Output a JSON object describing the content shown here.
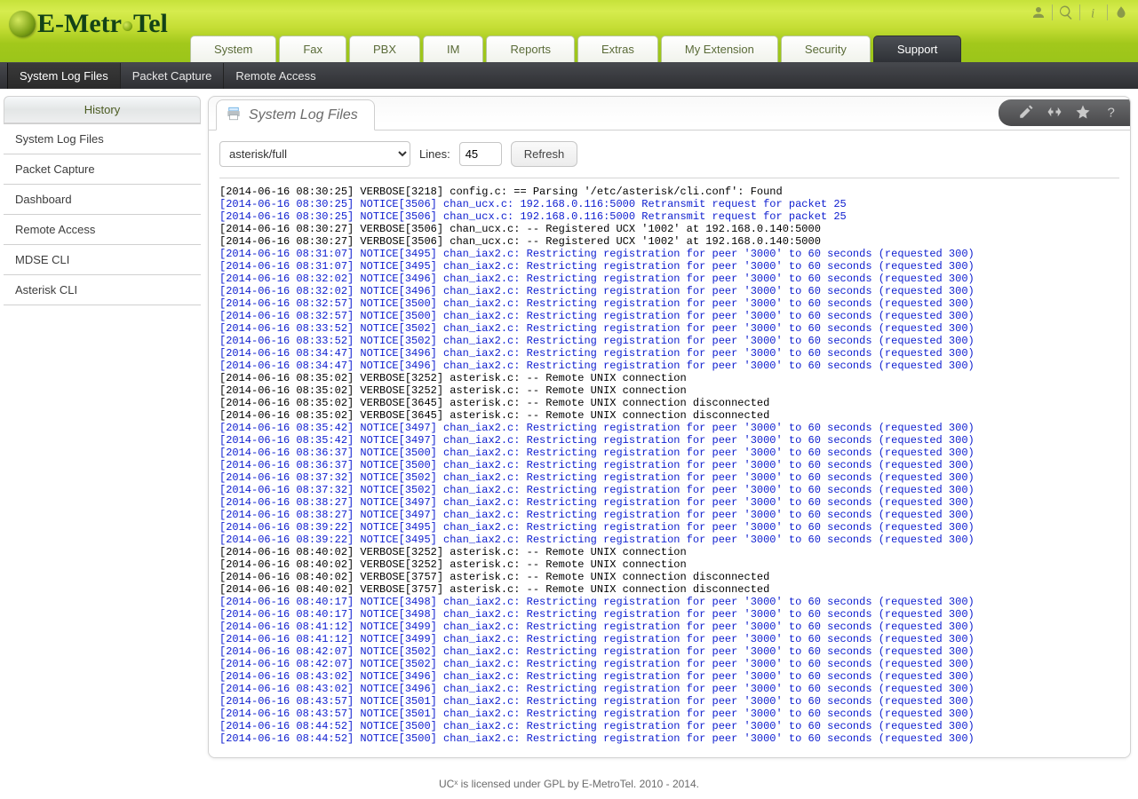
{
  "brand": {
    "text_e": "E",
    "text_metro": "-Metr",
    "text_tel": "Tel"
  },
  "tabs": [
    "System",
    "Fax",
    "PBX",
    "IM",
    "Reports",
    "Extras",
    "My Extension",
    "Security",
    "Support"
  ],
  "active_tab": 8,
  "subnav": [
    "System Log Files",
    "Packet Capture",
    "Remote Access"
  ],
  "subnav_active": 0,
  "sidebar_title": "History",
  "sidebar_items": [
    "System Log Files",
    "Packet Capture",
    "Dashboard",
    "Remote Access",
    "MDSE CLI",
    "Asterisk CLI"
  ],
  "panel_title": "System Log Files",
  "select_value": "asterisk/full",
  "lines_label": "Lines:",
  "lines_value": "45",
  "refresh_label": "Refresh",
  "footer": "UCˣ is licensed under GPL by E-MetroTel. 2010 - 2014.",
  "log_lines": [
    {
      "c": "def",
      "t": "[2014-06-16 08:30:25] VERBOSE[3218] config.c: == Parsing '/etc/asterisk/cli.conf': Found"
    },
    {
      "c": "blue",
      "t": "[2014-06-16 08:30:25] NOTICE[3506] chan_ucx.c: 192.168.0.116:5000 Retransmit request for packet 25"
    },
    {
      "c": "blue",
      "t": "[2014-06-16 08:30:25] NOTICE[3506] chan_ucx.c: 192.168.0.116:5000 Retransmit request for packet 25"
    },
    {
      "c": "def",
      "t": "[2014-06-16 08:30:27] VERBOSE[3506] chan_ucx.c: -- Registered UCX '1002' at 192.168.0.140:5000"
    },
    {
      "c": "def",
      "t": "[2014-06-16 08:30:27] VERBOSE[3506] chan_ucx.c: -- Registered UCX '1002' at 192.168.0.140:5000"
    },
    {
      "c": "blue",
      "t": "[2014-06-16 08:31:07] NOTICE[3495] chan_iax2.c: Restricting registration for peer '3000' to 60 seconds (requested 300)"
    },
    {
      "c": "blue",
      "t": "[2014-06-16 08:31:07] NOTICE[3495] chan_iax2.c: Restricting registration for peer '3000' to 60 seconds (requested 300)"
    },
    {
      "c": "blue",
      "t": "[2014-06-16 08:32:02] NOTICE[3496] chan_iax2.c: Restricting registration for peer '3000' to 60 seconds (requested 300)"
    },
    {
      "c": "blue",
      "t": "[2014-06-16 08:32:02] NOTICE[3496] chan_iax2.c: Restricting registration for peer '3000' to 60 seconds (requested 300)"
    },
    {
      "c": "blue",
      "t": "[2014-06-16 08:32:57] NOTICE[3500] chan_iax2.c: Restricting registration for peer '3000' to 60 seconds (requested 300)"
    },
    {
      "c": "blue",
      "t": "[2014-06-16 08:32:57] NOTICE[3500] chan_iax2.c: Restricting registration for peer '3000' to 60 seconds (requested 300)"
    },
    {
      "c": "blue",
      "t": "[2014-06-16 08:33:52] NOTICE[3502] chan_iax2.c: Restricting registration for peer '3000' to 60 seconds (requested 300)"
    },
    {
      "c": "blue",
      "t": "[2014-06-16 08:33:52] NOTICE[3502] chan_iax2.c: Restricting registration for peer '3000' to 60 seconds (requested 300)"
    },
    {
      "c": "blue",
      "t": "[2014-06-16 08:34:47] NOTICE[3496] chan_iax2.c: Restricting registration for peer '3000' to 60 seconds (requested 300)"
    },
    {
      "c": "blue",
      "t": "[2014-06-16 08:34:47] NOTICE[3496] chan_iax2.c: Restricting registration for peer '3000' to 60 seconds (requested 300)"
    },
    {
      "c": "def",
      "t": "[2014-06-16 08:35:02] VERBOSE[3252] asterisk.c: -- Remote UNIX connection"
    },
    {
      "c": "def",
      "t": "[2014-06-16 08:35:02] VERBOSE[3252] asterisk.c: -- Remote UNIX connection"
    },
    {
      "c": "def",
      "t": "[2014-06-16 08:35:02] VERBOSE[3645] asterisk.c: -- Remote UNIX connection disconnected"
    },
    {
      "c": "def",
      "t": "[2014-06-16 08:35:02] VERBOSE[3645] asterisk.c: -- Remote UNIX connection disconnected"
    },
    {
      "c": "blue",
      "t": "[2014-06-16 08:35:42] NOTICE[3497] chan_iax2.c: Restricting registration for peer '3000' to 60 seconds (requested 300)"
    },
    {
      "c": "blue",
      "t": "[2014-06-16 08:35:42] NOTICE[3497] chan_iax2.c: Restricting registration for peer '3000' to 60 seconds (requested 300)"
    },
    {
      "c": "blue",
      "t": "[2014-06-16 08:36:37] NOTICE[3500] chan_iax2.c: Restricting registration for peer '3000' to 60 seconds (requested 300)"
    },
    {
      "c": "blue",
      "t": "[2014-06-16 08:36:37] NOTICE[3500] chan_iax2.c: Restricting registration for peer '3000' to 60 seconds (requested 300)"
    },
    {
      "c": "blue",
      "t": "[2014-06-16 08:37:32] NOTICE[3502] chan_iax2.c: Restricting registration for peer '3000' to 60 seconds (requested 300)"
    },
    {
      "c": "blue",
      "t": "[2014-06-16 08:37:32] NOTICE[3502] chan_iax2.c: Restricting registration for peer '3000' to 60 seconds (requested 300)"
    },
    {
      "c": "blue",
      "t": "[2014-06-16 08:38:27] NOTICE[3497] chan_iax2.c: Restricting registration for peer '3000' to 60 seconds (requested 300)"
    },
    {
      "c": "blue",
      "t": "[2014-06-16 08:38:27] NOTICE[3497] chan_iax2.c: Restricting registration for peer '3000' to 60 seconds (requested 300)"
    },
    {
      "c": "blue",
      "t": "[2014-06-16 08:39:22] NOTICE[3495] chan_iax2.c: Restricting registration for peer '3000' to 60 seconds (requested 300)"
    },
    {
      "c": "blue",
      "t": "[2014-06-16 08:39:22] NOTICE[3495] chan_iax2.c: Restricting registration for peer '3000' to 60 seconds (requested 300)"
    },
    {
      "c": "def",
      "t": "[2014-06-16 08:40:02] VERBOSE[3252] asterisk.c: -- Remote UNIX connection"
    },
    {
      "c": "def",
      "t": "[2014-06-16 08:40:02] VERBOSE[3252] asterisk.c: -- Remote UNIX connection"
    },
    {
      "c": "def",
      "t": "[2014-06-16 08:40:02] VERBOSE[3757] asterisk.c: -- Remote UNIX connection disconnected"
    },
    {
      "c": "def",
      "t": "[2014-06-16 08:40:02] VERBOSE[3757] asterisk.c: -- Remote UNIX connection disconnected"
    },
    {
      "c": "blue",
      "t": "[2014-06-16 08:40:17] NOTICE[3498] chan_iax2.c: Restricting registration for peer '3000' to 60 seconds (requested 300)"
    },
    {
      "c": "blue",
      "t": "[2014-06-16 08:40:17] NOTICE[3498] chan_iax2.c: Restricting registration for peer '3000' to 60 seconds (requested 300)"
    },
    {
      "c": "blue",
      "t": "[2014-06-16 08:41:12] NOTICE[3499] chan_iax2.c: Restricting registration for peer '3000' to 60 seconds (requested 300)"
    },
    {
      "c": "blue",
      "t": "[2014-06-16 08:41:12] NOTICE[3499] chan_iax2.c: Restricting registration for peer '3000' to 60 seconds (requested 300)"
    },
    {
      "c": "blue",
      "t": "[2014-06-16 08:42:07] NOTICE[3502] chan_iax2.c: Restricting registration for peer '3000' to 60 seconds (requested 300)"
    },
    {
      "c": "blue",
      "t": "[2014-06-16 08:42:07] NOTICE[3502] chan_iax2.c: Restricting registration for peer '3000' to 60 seconds (requested 300)"
    },
    {
      "c": "blue",
      "t": "[2014-06-16 08:43:02] NOTICE[3496] chan_iax2.c: Restricting registration for peer '3000' to 60 seconds (requested 300)"
    },
    {
      "c": "blue",
      "t": "[2014-06-16 08:43:02] NOTICE[3496] chan_iax2.c: Restricting registration for peer '3000' to 60 seconds (requested 300)"
    },
    {
      "c": "blue",
      "t": "[2014-06-16 08:43:57] NOTICE[3501] chan_iax2.c: Restricting registration for peer '3000' to 60 seconds (requested 300)"
    },
    {
      "c": "blue",
      "t": "[2014-06-16 08:43:57] NOTICE[3501] chan_iax2.c: Restricting registration for peer '3000' to 60 seconds (requested 300)"
    },
    {
      "c": "blue",
      "t": "[2014-06-16 08:44:52] NOTICE[3500] chan_iax2.c: Restricting registration for peer '3000' to 60 seconds (requested 300)"
    },
    {
      "c": "blue",
      "t": "[2014-06-16 08:44:52] NOTICE[3500] chan_iax2.c: Restricting registration for peer '3000' to 60 seconds (requested 300)"
    }
  ]
}
